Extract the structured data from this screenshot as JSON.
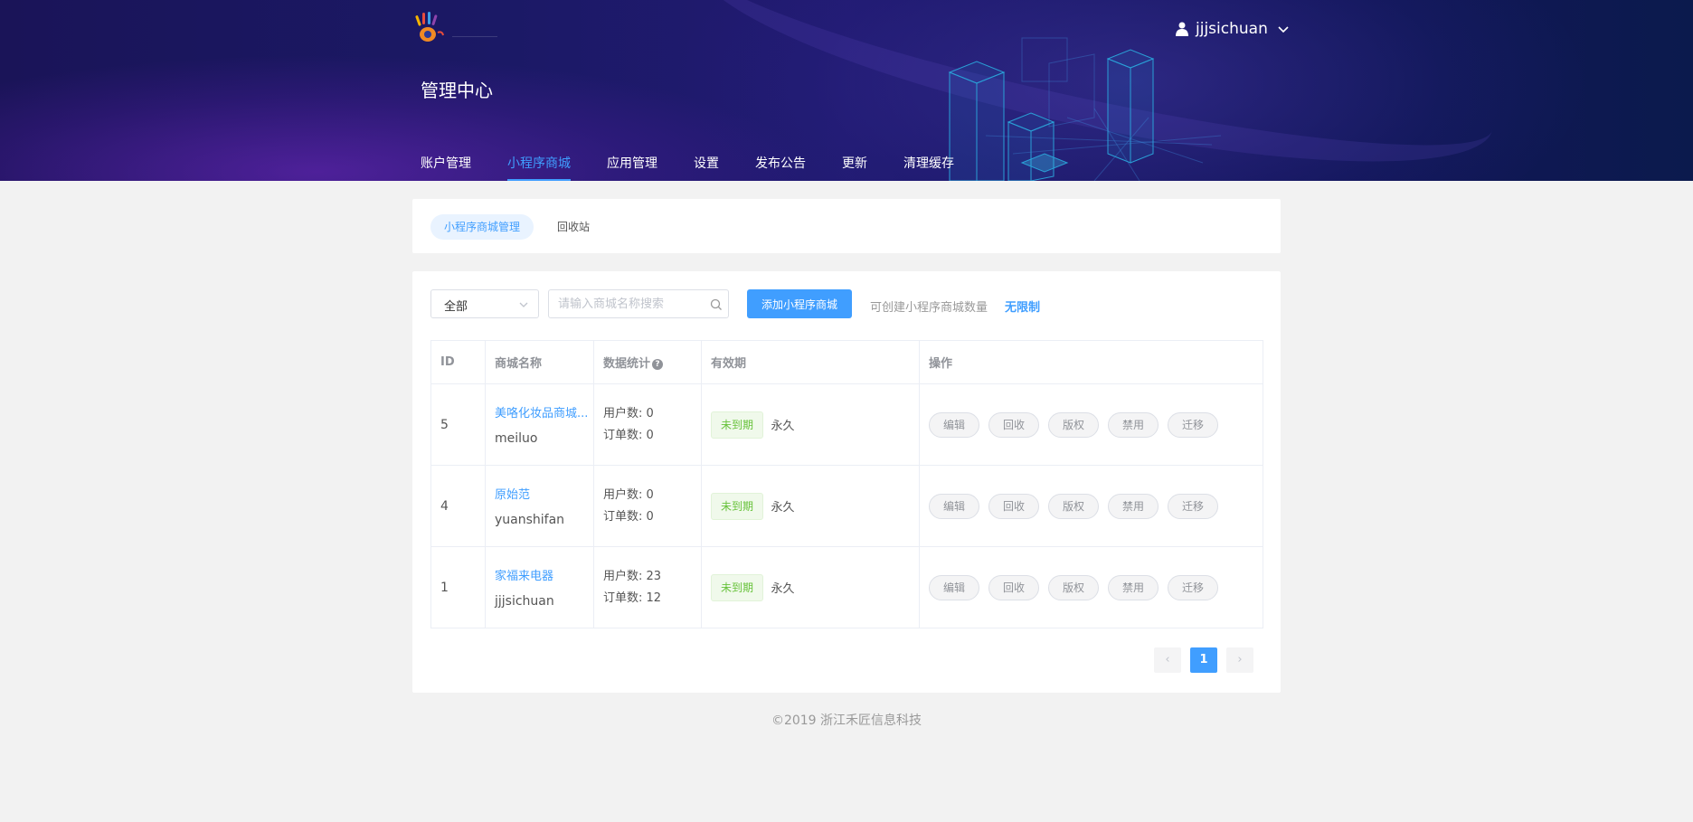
{
  "header": {
    "user_name": "jjjsichuan",
    "page_title": "管理中心",
    "nav": [
      {
        "label": "账户管理"
      },
      {
        "label": "小程序商城"
      },
      {
        "label": "应用管理"
      },
      {
        "label": "设置"
      },
      {
        "label": "发布公告"
      },
      {
        "label": "更新"
      },
      {
        "label": "清理缓存"
      }
    ],
    "active_nav_index": 1
  },
  "subtabs": {
    "active": "小程序商城管理",
    "inactive": "回收站"
  },
  "toolbar": {
    "filter_value": "全部",
    "search_placeholder": "请输入商城名称搜索",
    "add_label": "添加小程序商城",
    "quota_label": "可创建小程序商城数量",
    "quota_value": "无限制"
  },
  "table": {
    "headers": [
      "ID",
      "商城名称",
      "数据统计",
      "有效期",
      "操作"
    ],
    "rows": [
      {
        "id": "5",
        "name": "美咯化妆品商城...",
        "account": "meiluo",
        "users": "用户数: 0",
        "orders": "订单数: 0",
        "status": "未到期",
        "validity": "永久"
      },
      {
        "id": "4",
        "name": "原始范",
        "account": "yuanshifan",
        "users": "用户数: 0",
        "orders": "订单数: 0",
        "status": "未到期",
        "validity": "永久"
      },
      {
        "id": "1",
        "name": "家福来电器",
        "account": "jjjsichuan",
        "users": "用户数: 23",
        "orders": "订单数: 12",
        "status": "未到期",
        "validity": "永久"
      }
    ],
    "actions": [
      "编辑",
      "回收",
      "版权",
      "禁用",
      "迁移"
    ],
    "help_mark": "?"
  },
  "pagination": {
    "prev": "‹",
    "current": "1",
    "next": "›"
  },
  "footer": {
    "copyright": "©2019 浙江禾匠信息科技"
  },
  "colors": {
    "accent": "#409eff",
    "header_bg": "#1b1966",
    "success": "#67c23a"
  }
}
